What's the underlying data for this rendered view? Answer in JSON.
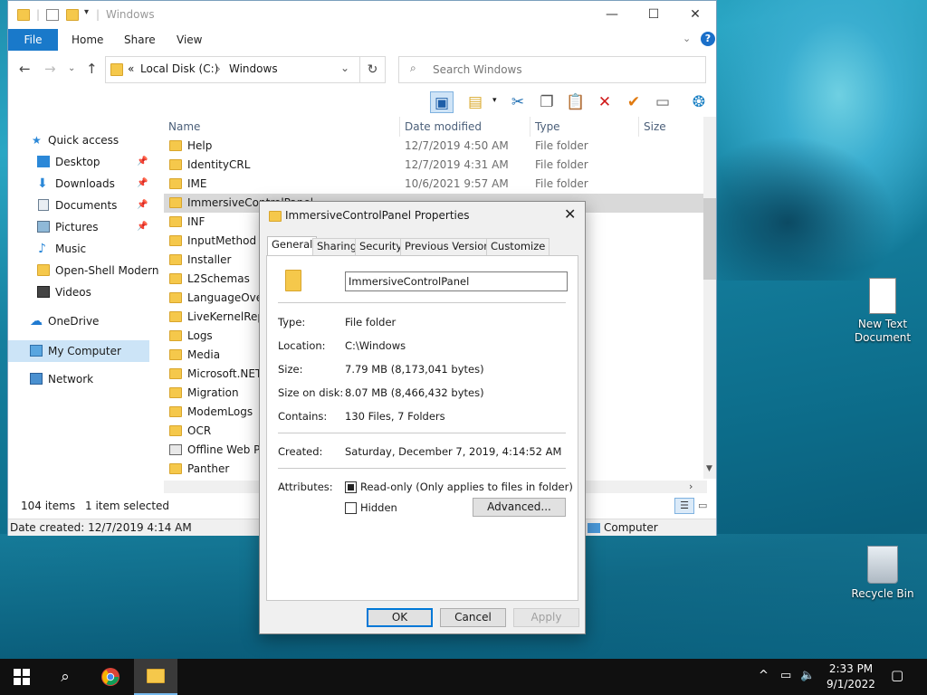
{
  "explorer": {
    "title": "Windows",
    "ribbon_tabs": [
      "File",
      "Home",
      "Share",
      "View"
    ],
    "help_label": "?",
    "address": {
      "prefix": "«",
      "parts": [
        "Local Disk (C:)",
        "Windows"
      ]
    },
    "search_placeholder": "Search Windows",
    "columns": {
      "name": "Name",
      "date": "Date modified",
      "type": "Type",
      "size": "Size"
    },
    "nav": {
      "quick_access": "Quick access",
      "items": [
        "Desktop",
        "Downloads",
        "Documents",
        "Pictures",
        "Music",
        "Open-Shell Modern",
        "Videos"
      ],
      "onedrive": "OneDrive",
      "my_computer": "My Computer",
      "network": "Network"
    },
    "files": [
      {
        "name": "Help",
        "date": "12/7/2019 4:50 AM",
        "type": "File folder"
      },
      {
        "name": "IdentityCRL",
        "date": "12/7/2019 4:31 AM",
        "type": "File folder"
      },
      {
        "name": "IME",
        "date": "10/6/2021 9:57 AM",
        "type": "File folder"
      },
      {
        "name": "ImmersiveControlPanel",
        "date": "",
        "type": ""
      },
      {
        "name": "INF",
        "date": "",
        "type": ""
      },
      {
        "name": "InputMethod",
        "date": "",
        "type": ""
      },
      {
        "name": "Installer",
        "date": "",
        "type": ""
      },
      {
        "name": "L2Schemas",
        "date": "",
        "type": ""
      },
      {
        "name": "LanguageOverl",
        "date": "",
        "type": ""
      },
      {
        "name": "LiveKernelRepo",
        "date": "",
        "type": ""
      },
      {
        "name": "Logs",
        "date": "",
        "type": ""
      },
      {
        "name": "Media",
        "date": "",
        "type": ""
      },
      {
        "name": "Microsoft.NET",
        "date": "",
        "type": ""
      },
      {
        "name": "Migration",
        "date": "",
        "type": ""
      },
      {
        "name": "ModemLogs",
        "date": "",
        "type": ""
      },
      {
        "name": "OCR",
        "date": "",
        "type": ""
      },
      {
        "name": "Offline Web Pa",
        "date": "",
        "type": ""
      },
      {
        "name": "Panther",
        "date": "",
        "type": ""
      }
    ],
    "status": {
      "count": "104 items",
      "selected": "1 item selected"
    },
    "details_bar": {
      "created": "Date created: 12/7/2019 4:14 AM",
      "location": "Computer"
    }
  },
  "dialog": {
    "title": "ImmersiveControlPanel Properties",
    "tabs": [
      "General",
      "Sharing",
      "Security",
      "Previous Versions",
      "Customize"
    ],
    "name_value": "ImmersiveControlPanel",
    "fields": {
      "type_label": "Type:",
      "type_value": "File folder",
      "location_label": "Location:",
      "location_value": "C:\\Windows",
      "size_label": "Size:",
      "size_value": "7.79 MB (8,173,041 bytes)",
      "disk_label": "Size on disk:",
      "disk_value": "8.07 MB (8,466,432 bytes)",
      "contains_label": "Contains:",
      "contains_value": "130 Files, 7 Folders",
      "created_label": "Created:",
      "created_value": "Saturday, December 7, 2019, 4:14:52 AM",
      "attributes_label": "Attributes:"
    },
    "readonly_label": "Read-only (Only applies to files in folder)",
    "readonly_checked": true,
    "hidden_label": "Hidden",
    "hidden_checked": false,
    "advanced_label": "Advanced...",
    "ok_label": "OK",
    "cancel_label": "Cancel",
    "apply_label": "Apply"
  },
  "desktop": {
    "new_text_doc": [
      "New Text",
      "Document"
    ],
    "recycle_bin": "Recycle Bin"
  },
  "taskbar": {
    "time": "2:33 PM",
    "date": "9/1/2022"
  },
  "colors": {
    "accent": "#1979ca",
    "selection": "#d9d9d9",
    "taskbar": "#101010"
  }
}
